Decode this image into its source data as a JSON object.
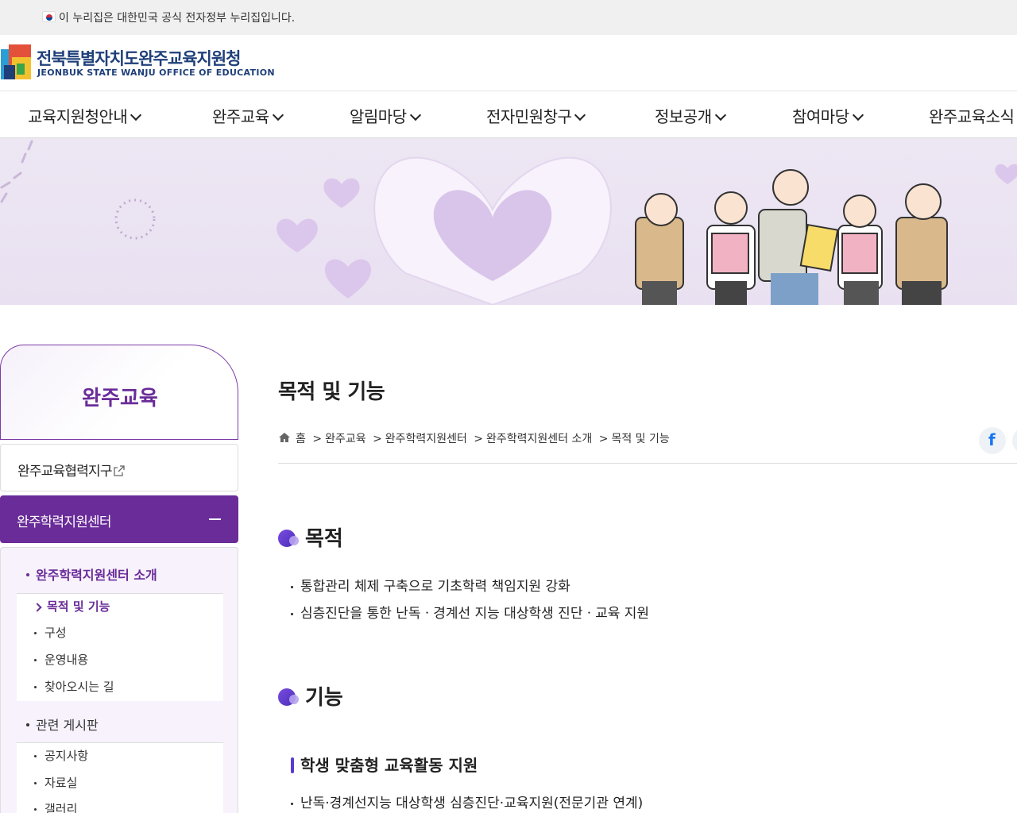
{
  "gov_banner": {
    "text": "이 누리집은 대한민국 공식 전자정부 누리집입니다."
  },
  "header": {
    "logo_ko": "전북특별자치도완주교육지원청",
    "logo_en": "JEONBUK STATE WANJU OFFICE OF EDUCATION"
  },
  "gnb": {
    "items": [
      {
        "label": "교육지원청안내"
      },
      {
        "label": "완주교육"
      },
      {
        "label": "알림마당"
      },
      {
        "label": "전자민원창구"
      },
      {
        "label": "정보공개"
      },
      {
        "label": "참여마당"
      },
      {
        "label": "완주교육소식"
      }
    ]
  },
  "lnb": {
    "title": "완주교육",
    "external_link": "완주교육협력지구",
    "active_menu": "완주학력지원센터",
    "groups": [
      {
        "label": "완주학력지원센터 소개",
        "items": [
          "목적 및 기능",
          "구성",
          "운영내용",
          "찾아오시는 길"
        ]
      },
      {
        "label": "관련 게시판",
        "items": [
          "공지사항",
          "자료실",
          "갤러리"
        ]
      }
    ]
  },
  "content": {
    "page_title": "목적 및 기능",
    "breadcrumb": [
      "홈",
      "완주교육",
      "완주학력지원센터",
      "완주학력지원센터 소개",
      "목적 및 기능"
    ],
    "breadcrumb_sep": ">",
    "share_facebook": "f",
    "section1": {
      "heading": "목적",
      "bullets": [
        "통합관리 체제 구축으로 기초학력 책임지원 강화",
        "심층진단을 통한 난독ㆍ경계선 지능 대상학생 진단ㆍ교육 지원"
      ]
    },
    "section2": {
      "heading": "기능",
      "subtitle": "학생 맞춤형 교육활동 지원",
      "bullets": [
        "난독·경계선지능 대상학생 심층진단·교육지원(전문기관 연계)"
      ]
    }
  },
  "colors": {
    "brand": "#6a2c99",
    "accent": "#5b3ad1",
    "logo": "#1f3f7a"
  }
}
